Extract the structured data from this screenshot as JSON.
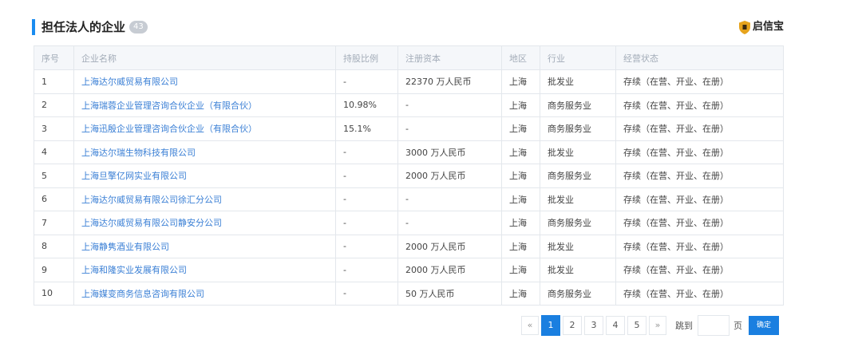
{
  "header": {
    "title": "担任法人的企业",
    "count": "43",
    "brand": "启信宝",
    "brand_color": "#e6a31c",
    "accent_color": "#1a8cf0"
  },
  "table": {
    "columns": [
      "序号",
      "企业名称",
      "持股比例",
      "注册资本",
      "地区",
      "行业",
      "经营状态"
    ],
    "rows": [
      [
        "1",
        "上海达尔威贸易有限公司",
        "-",
        "22370 万人民币",
        "上海",
        "批发业",
        "存续（在营、开业、在册）"
      ],
      [
        "2",
        "上海瑞蓉企业管理咨询合伙企业（有限合伙）",
        "10.98%",
        "-",
        "上海",
        "商务服务业",
        "存续（在营、开业、在册）"
      ],
      [
        "3",
        "上海迅殷企业管理咨询合伙企业（有限合伙）",
        "15.1%",
        "-",
        "上海",
        "商务服务业",
        "存续（在营、开业、在册）"
      ],
      [
        "4",
        "上海达尔瑞生物科技有限公司",
        "-",
        "3000 万人民币",
        "上海",
        "批发业",
        "存续（在营、开业、在册）"
      ],
      [
        "5",
        "上海旦擎亿网实业有限公司",
        "-",
        "2000 万人民币",
        "上海",
        "商务服务业",
        "存续（在营、开业、在册）"
      ],
      [
        "6",
        "上海达尔威贸易有限公司徐汇分公司",
        "-",
        "-",
        "上海",
        "批发业",
        "存续（在营、开业、在册）"
      ],
      [
        "7",
        "上海达尔威贸易有限公司静安分公司",
        "-",
        "-",
        "上海",
        "商务服务业",
        "存续（在营、开业、在册）"
      ],
      [
        "8",
        "上海静隽酒业有限公司",
        "-",
        "2000 万人民币",
        "上海",
        "批发业",
        "存续（在营、开业、在册）"
      ],
      [
        "9",
        "上海和隆实业发展有限公司",
        "-",
        "2000 万人民币",
        "上海",
        "批发业",
        "存续（在营、开业、在册）"
      ],
      [
        "10",
        "上海媒变商务信息咨询有限公司",
        "-",
        "50 万人民币",
        "上海",
        "商务服务业",
        "存续（在营、开业、在册）"
      ]
    ]
  },
  "pagination": {
    "prev": "«",
    "pages": [
      "1",
      "2",
      "3",
      "4",
      "5"
    ],
    "current": "1",
    "next": "»",
    "jump_label": "跳到",
    "jump_value": "",
    "page_unit": "页",
    "confirm": "确定"
  }
}
